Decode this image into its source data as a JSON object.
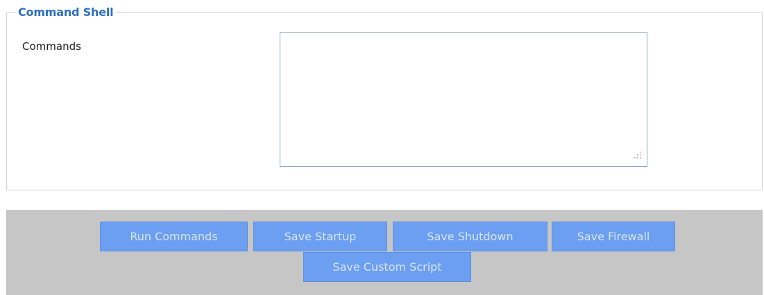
{
  "section": {
    "legend": "Command Shell",
    "commands_label": "Commands",
    "commands_value": ""
  },
  "buttons": {
    "run_commands": "Run Commands",
    "save_startup": "Save Startup",
    "save_shutdown": "Save Shutdown",
    "save_firewall": "Save Firewall",
    "save_custom_script": "Save Custom Script"
  },
  "colors": {
    "legend_text": "#2c6fc2",
    "button_bg": "#6c9ff2",
    "button_text": "#d7e5fb",
    "button_bar_bg": "#c6c6c6",
    "textarea_border": "#8da6c3"
  },
  "icons": {
    "resize_grip": "resize-grip-icon"
  }
}
